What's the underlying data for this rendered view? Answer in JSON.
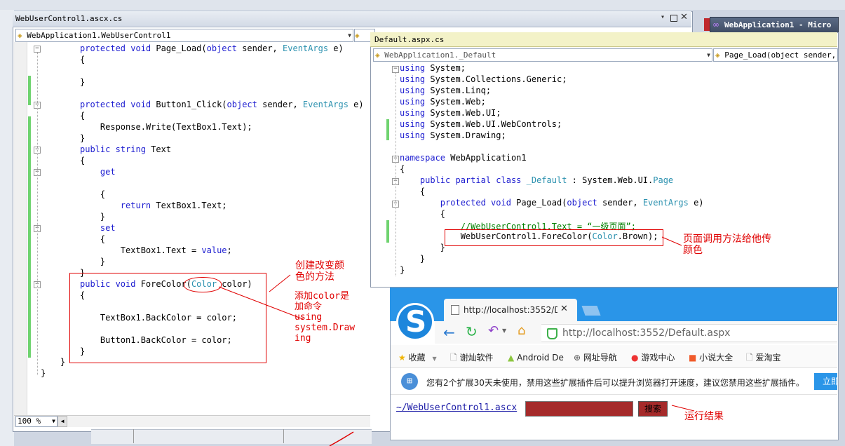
{
  "left_window": {
    "title": "WebUserControl1.ascx.cs",
    "class_dropdown": "WebApplication1.WebUserControl1",
    "zoom": "100 %",
    "code": [
      [
        {
          "t": "protected void ",
          "c": "kw"
        },
        {
          "t": "Page_Load(",
          "c": "tx"
        },
        {
          "t": "object",
          "c": "kw"
        },
        {
          "t": " sender, ",
          "c": "tx"
        },
        {
          "t": "EventArgs",
          "c": "ty"
        },
        {
          "t": " e)",
          "c": "tx"
        }
      ],
      [
        {
          "t": "{",
          "c": "tx"
        }
      ],
      [],
      [
        {
          "t": "}",
          "c": "tx"
        }
      ],
      [],
      [
        {
          "t": "protected void ",
          "c": "kw"
        },
        {
          "t": "Button1_Click(",
          "c": "tx"
        },
        {
          "t": "object",
          "c": "kw"
        },
        {
          "t": " sender, ",
          "c": "tx"
        },
        {
          "t": "EventArgs",
          "c": "ty"
        },
        {
          "t": " e)",
          "c": "tx"
        }
      ],
      [
        {
          "t": "{",
          "c": "tx"
        }
      ],
      [
        {
          "t": "    Response.Write(TextBox1.Text);",
          "c": "tx"
        }
      ],
      [
        {
          "t": "}",
          "c": "tx"
        }
      ],
      [
        {
          "t": "public string ",
          "c": "kw"
        },
        {
          "t": "Text",
          "c": "tx"
        }
      ],
      [
        {
          "t": "{",
          "c": "tx"
        }
      ],
      [
        {
          "t": "    get",
          "c": "kw"
        }
      ],
      [],
      [
        {
          "t": "    {",
          "c": "tx"
        }
      ],
      [
        {
          "t": "        return ",
          "c": "kw"
        },
        {
          "t": "TextBox1.Text;",
          "c": "tx"
        }
      ],
      [
        {
          "t": "    }",
          "c": "tx"
        }
      ],
      [
        {
          "t": "    set",
          "c": "kw"
        }
      ],
      [
        {
          "t": "    {",
          "c": "tx"
        }
      ],
      [
        {
          "t": "        TextBox1.Text = ",
          "c": "tx"
        },
        {
          "t": "value",
          "c": "kw"
        },
        {
          "t": ";",
          "c": "tx"
        }
      ],
      [
        {
          "t": "    }",
          "c": "tx"
        }
      ],
      [
        {
          "t": "}",
          "c": "tx"
        }
      ],
      [
        {
          "t": "public void ",
          "c": "kw"
        },
        {
          "t": "ForeColor(",
          "c": "tx"
        },
        {
          "t": "Color",
          "c": "ty"
        },
        {
          "t": " color)",
          "c": "tx"
        }
      ],
      [
        {
          "t": "{",
          "c": "tx"
        }
      ],
      [],
      [
        {
          "t": "    TextBox1.BackColor = color;",
          "c": "tx"
        }
      ],
      [],
      [
        {
          "t": "    Button1.BackColor = color;",
          "c": "tx"
        }
      ],
      [
        {
          "t": "}",
          "c": "tx"
        }
      ]
    ],
    "closing1": "}",
    "closing2": "}"
  },
  "right_window": {
    "title": "Default.aspx.cs",
    "class_dropdown": "WebApplication1._Default",
    "member_dropdown": "Page_Load(object sender, E",
    "code": [
      [
        {
          "t": "using ",
          "c": "kw"
        },
        {
          "t": "System;",
          "c": "tx"
        }
      ],
      [
        {
          "t": "using ",
          "c": "kw"
        },
        {
          "t": "System.Collections.Generic;",
          "c": "tx"
        }
      ],
      [
        {
          "t": "using ",
          "c": "kw"
        },
        {
          "t": "System.Linq;",
          "c": "tx"
        }
      ],
      [
        {
          "t": "using ",
          "c": "kw"
        },
        {
          "t": "System.Web;",
          "c": "tx"
        }
      ],
      [
        {
          "t": "using ",
          "c": "kw"
        },
        {
          "t": "System.Web.UI;",
          "c": "tx"
        }
      ],
      [
        {
          "t": "using ",
          "c": "kw"
        },
        {
          "t": "System.Web.UI.WebControls;",
          "c": "tx"
        }
      ],
      [
        {
          "t": "using ",
          "c": "kw"
        },
        {
          "t": "System.Drawing;",
          "c": "tx"
        }
      ],
      [],
      [
        {
          "t": "namespace ",
          "c": "kw"
        },
        {
          "t": "WebApplication1",
          "c": "tx"
        }
      ],
      [
        {
          "t": "{",
          "c": "tx"
        }
      ],
      [
        {
          "t": "    public partial class ",
          "c": "kw"
        },
        {
          "t": "_Default",
          "c": "ty"
        },
        {
          "t": " : System.Web.UI.",
          "c": "tx"
        },
        {
          "t": "Page",
          "c": "ty"
        }
      ],
      [
        {
          "t": "    {",
          "c": "tx"
        }
      ],
      [
        {
          "t": "        protected void ",
          "c": "kw"
        },
        {
          "t": "Page_Load(",
          "c": "tx"
        },
        {
          "t": "object",
          "c": "kw"
        },
        {
          "t": " sender, ",
          "c": "tx"
        },
        {
          "t": "EventArgs",
          "c": "ty"
        },
        {
          "t": " e)",
          "c": "tx"
        }
      ],
      [
        {
          "t": "        {",
          "c": "tx"
        }
      ],
      [
        {
          "t": "            //WebUserControl1.Text = “一级页面”;",
          "c": "cm"
        }
      ],
      [
        {
          "t": "            WebUserControl1.ForeColor(",
          "c": "tx"
        },
        {
          "t": "Color",
          "c": "ty"
        },
        {
          "t": ".Brown);",
          "c": "tx"
        }
      ],
      [
        {
          "t": "        }",
          "c": "tx"
        }
      ],
      [
        {
          "t": "    }",
          "c": "tx"
        }
      ],
      [
        {
          "t": "}",
          "c": "tx"
        }
      ]
    ]
  },
  "top_right_window": {
    "title": "WebApplication1 - Micro"
  },
  "annotations": {
    "create_method": "创建改变颜\n色的方法",
    "add_using": "添加color是\n加命令\nusing\nsystem.Draw\ning",
    "page_call": "页面调用方法给他传\n颜色",
    "result": "运行结果"
  },
  "browser": {
    "tab_title": "http://localhost:3552/D",
    "address": "http://localhost:3552/Default.aspx",
    "bookmarks": [
      "收藏",
      "谢灿软件",
      "Android De",
      "网址导航",
      "游戏中心",
      "小说大全",
      "爱淘宝"
    ],
    "notice": "您有2个扩展30天未使用，禁用这些扩展插件后可以提升浏览器打开速度，建议您禁用这些扩展插件。",
    "notice_button": "立即",
    "page_link": "~/WebUserControl1.ascx",
    "search_button": "搜索",
    "textbox_color": "#a52a2a"
  },
  "colors": {
    "keyword": "#1c1cd0",
    "type": "#2b91af",
    "comment": "#008000",
    "annotation": "#e00000",
    "brand_blue": "#2a95e8"
  }
}
